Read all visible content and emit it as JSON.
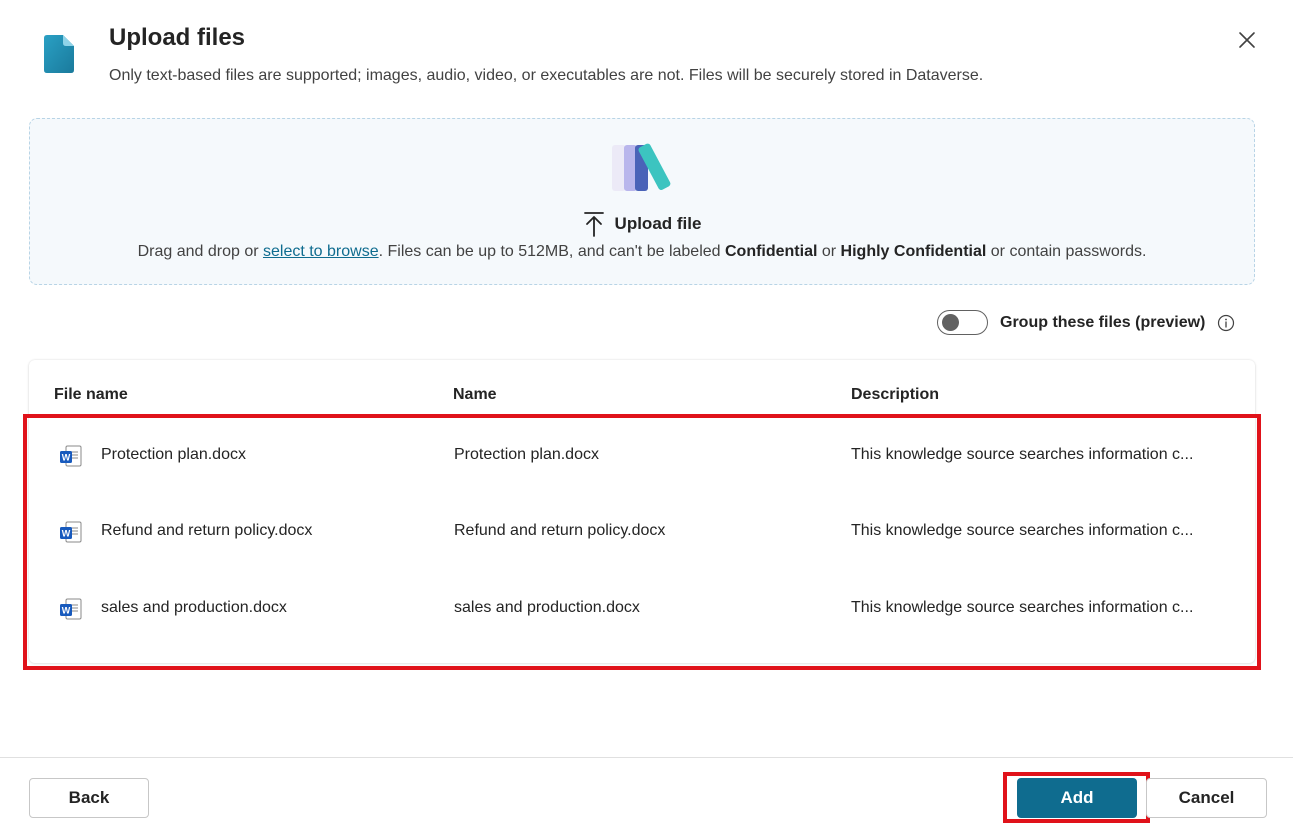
{
  "dialog": {
    "title": "Upload files",
    "subtitle": "Only text-based files are supported; images, audio, video, or executables are not. Files will be securely stored in Dataverse.",
    "header_icon": "document-icon",
    "close_icon": "close-icon"
  },
  "dropzone": {
    "upload_label": "Upload file",
    "text_prefix": "Drag and drop or ",
    "browse_link": "select to browse",
    "text_middle": ". Files can be up to 512MB, and can't be labeled ",
    "confidential": "Confidential",
    "text_or": " or ",
    "highly_confidential": "Highly Confidential",
    "text_suffix": " or contain passwords."
  },
  "group_toggle": {
    "label": "Group these files (preview)",
    "on": false
  },
  "table": {
    "headers": [
      "File name",
      "Name",
      "Description"
    ],
    "rows": [
      {
        "file_name": "Protection plan.docx",
        "name": "Protection plan.docx",
        "description": "This knowledge source searches information c..."
      },
      {
        "file_name": "Refund and return policy.docx",
        "name": "Refund and return policy.docx",
        "description": "This knowledge source searches information c..."
      },
      {
        "file_name": "sales and production.docx",
        "name": "sales and production.docx",
        "description": "This knowledge source searches information c..."
      }
    ]
  },
  "footer": {
    "back_label": "Back",
    "add_label": "Add",
    "cancel_label": "Cancel"
  },
  "colors": {
    "accent": "#0f6c8f",
    "highlight": "#e0121a",
    "word_blue": "#185abd"
  }
}
